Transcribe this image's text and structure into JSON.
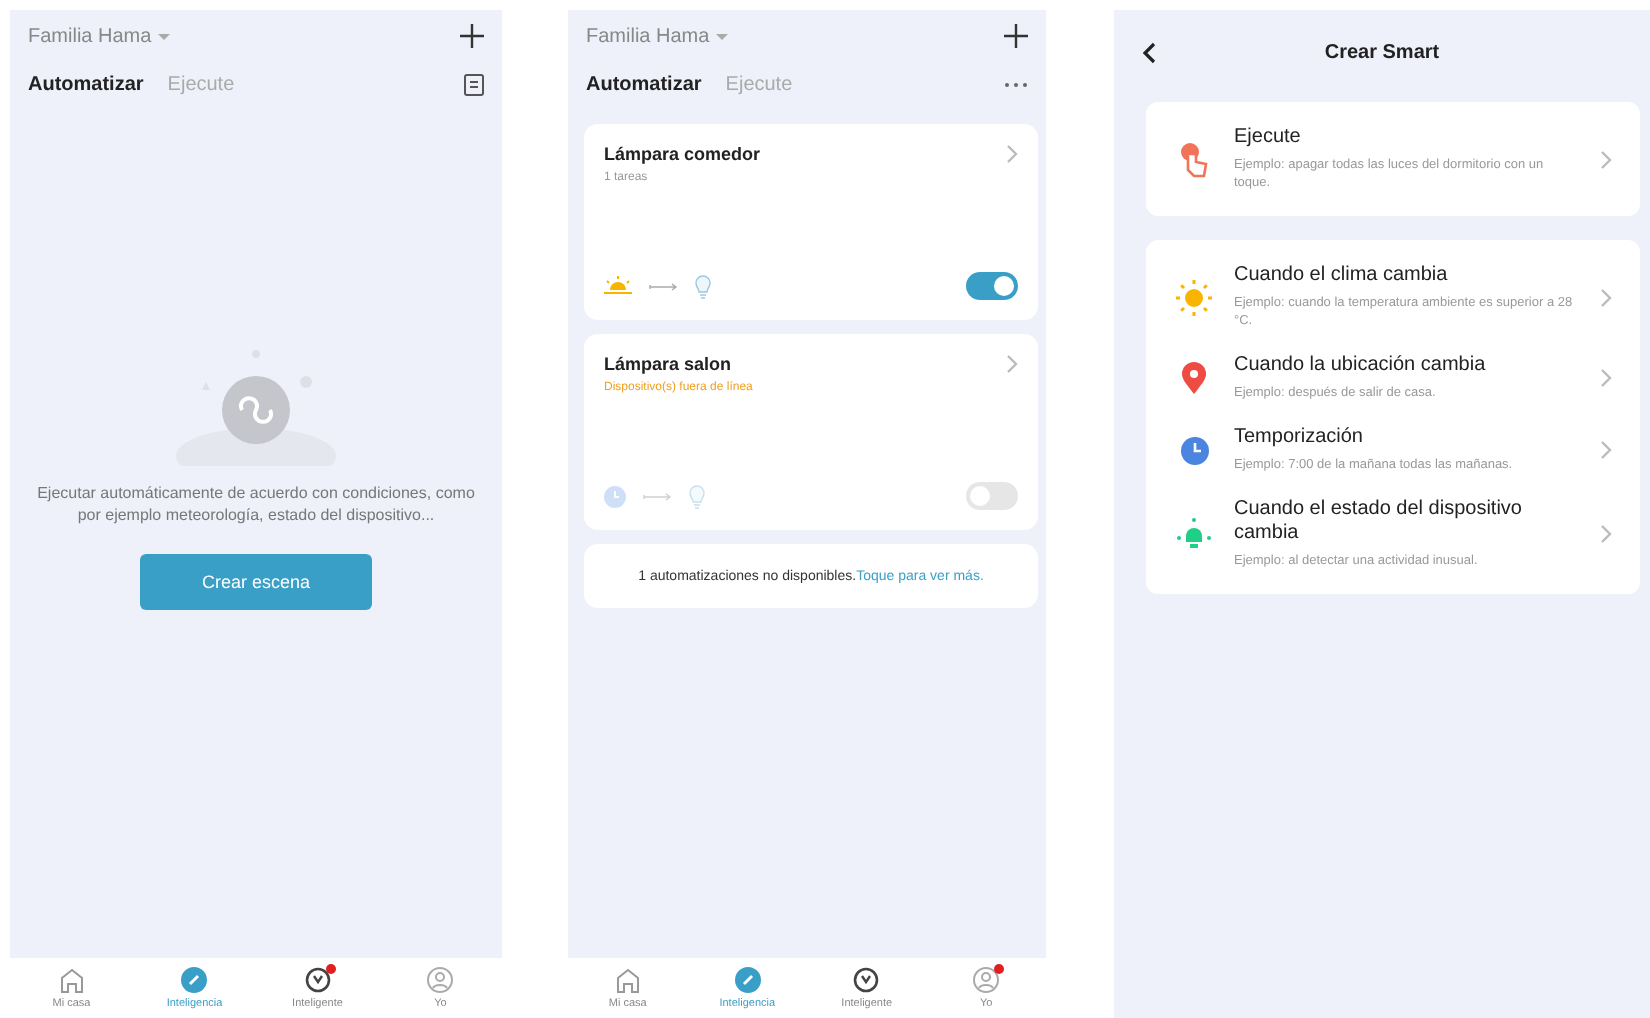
{
  "screens": [
    {
      "kind": "empty",
      "header": {
        "home": "Familia Hama",
        "action": {
          "kind": "log"
        }
      },
      "tabs": [
        {
          "label": "Automatizar",
          "selected": true
        },
        {
          "label": "Ejecute",
          "selected": false
        }
      ],
      "empty_text": "Ejecutar automáticamente de acuerdo con condiciones, como por ejemplo meteorología, estado del dispositivo...",
      "button": "Crear escena",
      "nav": [
        {
          "kind": "home",
          "label": "Mi casa",
          "selected": false,
          "badge": false
        },
        {
          "kind": "smart",
          "label": "Inteligencia",
          "selected": true,
          "badge": false
        },
        {
          "kind": "compass",
          "label": "Inteligente",
          "selected": false,
          "badge": true
        },
        {
          "kind": "profile",
          "label": "Yo",
          "selected": false,
          "badge": false
        }
      ]
    },
    {
      "kind": "list",
      "header": {
        "home": "Familia Hama",
        "action": {
          "kind": "more"
        }
      },
      "tabs": [
        {
          "label": "Automatizar",
          "selected": true
        },
        {
          "label": "Ejecute",
          "selected": false
        }
      ],
      "cards": [
        {
          "title": "Lámpara comedor",
          "subtitle": "1 tareas",
          "warning": false,
          "trigger": {
            "kind": "sunrise"
          },
          "disabled": false,
          "on": true
        },
        {
          "title": "Lámpara salon",
          "subtitle": "Dispositivo(s) fuera de línea",
          "warning": true,
          "trigger": {
            "kind": "clock"
          },
          "disabled": true,
          "on": false
        }
      ],
      "notice": {
        "text": "1 automatizaciones no disponibles.",
        "link": "Toque para ver más."
      },
      "nav": [
        {
          "kind": "home",
          "label": "Mi casa",
          "selected": false,
          "badge": false
        },
        {
          "kind": "smart",
          "label": "Inteligencia",
          "selected": true,
          "badge": false
        },
        {
          "kind": "compass",
          "label": "Inteligente",
          "selected": false,
          "badge": false
        },
        {
          "kind": "profile",
          "label": "Yo",
          "selected": false,
          "badge": true
        }
      ]
    },
    {
      "kind": "create",
      "title": "Crear Smart",
      "groups": [
        [
          {
            "kind": "tap",
            "title": "Ejecute",
            "desc": "Ejemplo: apagar todas las luces del dormitorio con un toque."
          }
        ],
        [
          {
            "kind": "weather",
            "title": "Cuando el clima cambia",
            "desc": "Ejemplo: cuando la temperatura ambiente es superior a 28 °C."
          },
          {
            "kind": "location",
            "title": "Cuando la ubicación cambia",
            "desc": "Ejemplo: después de salir de casa."
          },
          {
            "kind": "timer",
            "title": "Temporización",
            "desc": "Ejemplo: 7:00 de la mañana todas las mañanas."
          },
          {
            "kind": "device",
            "title": "Cuando el estado del dispositivo cambia",
            "desc": "Ejemplo: al detectar una actividad inusual."
          }
        ]
      ]
    }
  ]
}
